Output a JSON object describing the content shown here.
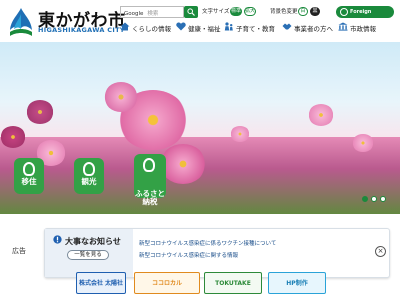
{
  "header": {
    "logo_title": "東かがわ市",
    "logo_sub": "HIGASHIKAGAWA CITY",
    "search": {
      "tag": "Google",
      "placeholder": "検索"
    },
    "font_size_label": "文字サイズ",
    "font_size_options": [
      "標準",
      "拡大"
    ],
    "color_label": "背景色変更",
    "color_options": [
      "白",
      "黒"
    ],
    "language_button": "Foreign Language"
  },
  "nav": {
    "items": [
      {
        "label": "くらしの情報",
        "icon": "home-icon"
      },
      {
        "label": "健康・福祉",
        "icon": "heart-icon"
      },
      {
        "label": "子育て・教育",
        "icon": "family-icon"
      },
      {
        "label": "事業者の方へ",
        "icon": "handshake-icon"
      },
      {
        "label": "市政情報",
        "icon": "building-icon"
      }
    ]
  },
  "hero": {
    "buttons": [
      {
        "label": "移住"
      },
      {
        "label": "観光"
      },
      {
        "label": "ふるさと\n納税"
      }
    ],
    "slides": 3,
    "active_slide": 1
  },
  "notice": {
    "ad_label": "広告",
    "title": "大事なお知らせ",
    "more_button": "一覧を見る",
    "items": [
      "新型コロナウイルス感染症に係るワクチン接種について",
      "新型コロナウイルス感染症に関する情報"
    ]
  },
  "banners": [
    {
      "label": "株式会社 太陽社",
      "color": "#1f5fb0"
    },
    {
      "label": "ココロカル",
      "color": "#e08a1e"
    },
    {
      "label": "TOKUTAKE",
      "color": "#2d8a3a"
    },
    {
      "label": "HP制作",
      "color": "#2aa3d8"
    }
  ],
  "colors": {
    "accent": "#1a8a3c",
    "logo_blue": "#1f6fb5"
  }
}
